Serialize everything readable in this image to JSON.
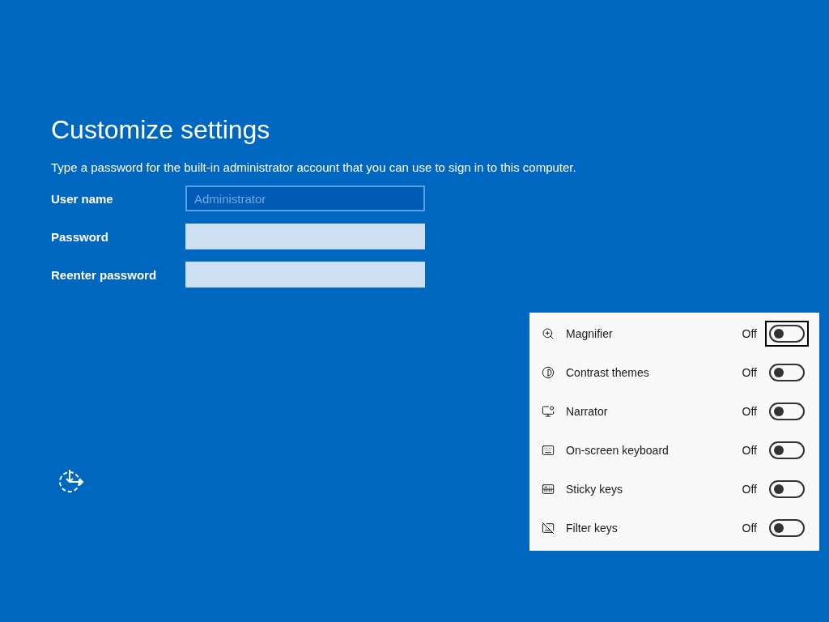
{
  "title": "Customize settings",
  "description": "Type a password for the built-in administrator account that you can use to sign in to this computer.",
  "fields": [
    {
      "label": "User name",
      "value": "Administrator",
      "disabled": true
    },
    {
      "label": "Password",
      "disabled": false
    },
    {
      "label": "Reenter password",
      "disabled": false
    }
  ],
  "accessibility_panel": {
    "items": [
      {
        "kind": "magnifier",
        "label": "Magnifier",
        "state": "Off",
        "on": false,
        "focused": true
      },
      {
        "kind": "contrast",
        "label": "Contrast themes",
        "state": "Off",
        "on": false,
        "focused": false
      },
      {
        "kind": "narrator",
        "label": "Narrator",
        "state": "Off",
        "on": false,
        "focused": false
      },
      {
        "kind": "keyboard",
        "label": "On-screen keyboard",
        "state": "Off",
        "on": false,
        "focused": false
      },
      {
        "kind": "sticky",
        "label": "Sticky keys",
        "state": "Off",
        "on": false,
        "focused": false
      },
      {
        "kind": "filter",
        "label": "Filter keys",
        "state": "Off",
        "on": false,
        "focused": false
      }
    ]
  }
}
